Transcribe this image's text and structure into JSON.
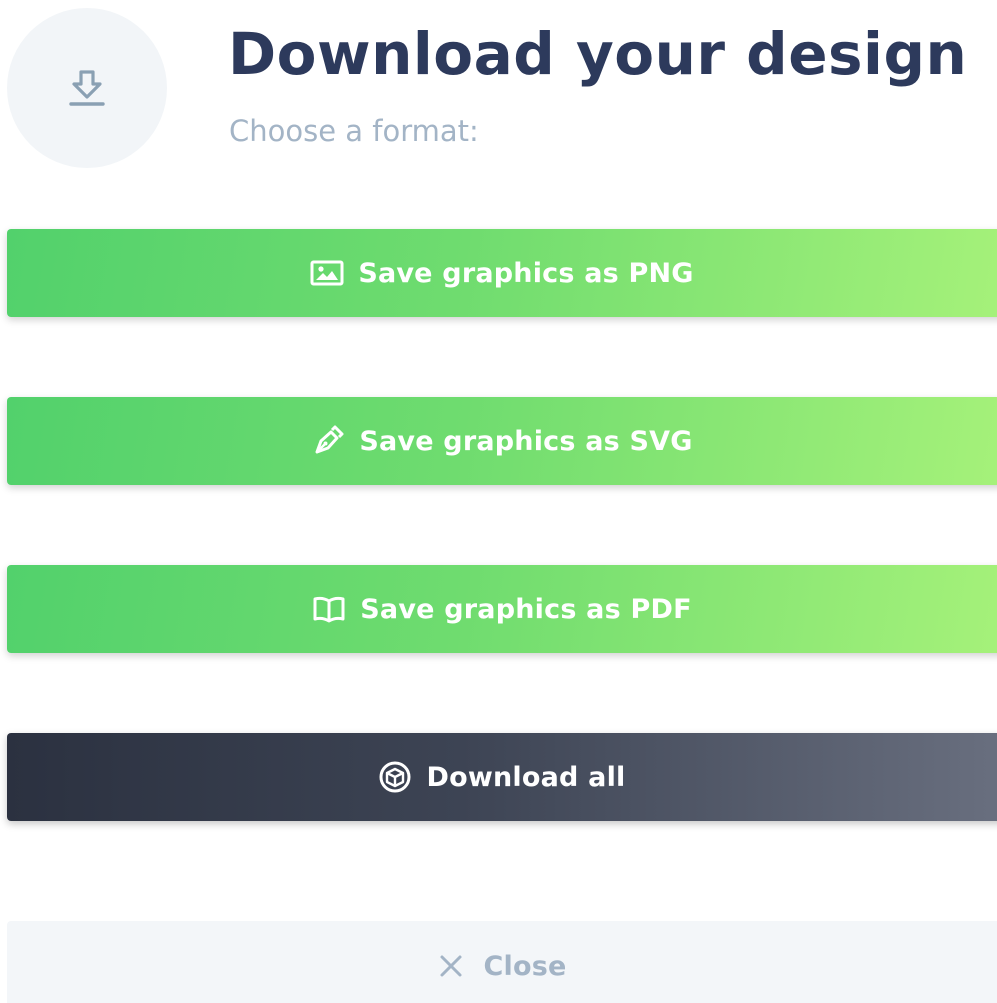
{
  "header": {
    "icon": "download-icon",
    "title": "Download your design",
    "subtitle": "Choose a format:"
  },
  "actions": [
    {
      "label": "Save graphics as PNG",
      "icon": "image-icon",
      "style": "green"
    },
    {
      "label": "Save graphics as SVG",
      "icon": "pen-nib-icon",
      "style": "green"
    },
    {
      "label": "Save graphics as PDF",
      "icon": "open-book-icon",
      "style": "green"
    },
    {
      "label": "Download all",
      "icon": "package-box-icon",
      "style": "dark"
    }
  ],
  "close": {
    "label": "Close",
    "icon": "close-icon"
  },
  "colors": {
    "title": "#2d3a5c",
    "muted": "#a3b4c6",
    "green_start": "#52d16c",
    "green_end": "#a7f27a",
    "dark_start": "#2b3140",
    "dark_end": "#6a7080",
    "icon_circle_bg": "#f2f5f8",
    "close_bg": "#f3f6f9"
  }
}
